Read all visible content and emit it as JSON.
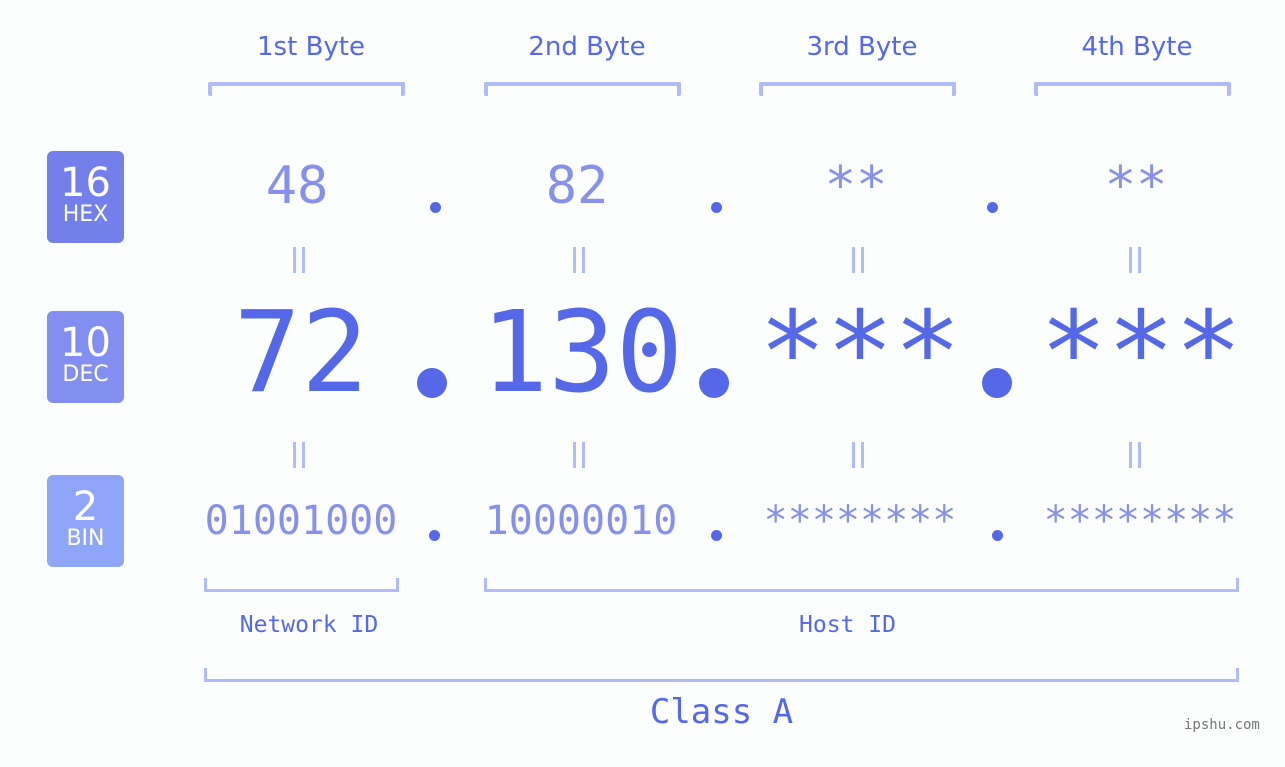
{
  "bytes": {
    "headers": [
      "1st Byte",
      "2nd Byte",
      "3rd Byte",
      "4th Byte"
    ]
  },
  "badges": {
    "hex": {
      "num": "16",
      "label": "HEX",
      "color": "#7380ec"
    },
    "dec": {
      "num": "10",
      "label": "DEC",
      "color": "#838ff0"
    },
    "bin": {
      "num": "2",
      "label": "BIN",
      "color": "#8fa6f8"
    }
  },
  "hex": [
    "48",
    "82",
    "**",
    "**"
  ],
  "dec": [
    "72",
    "130",
    "***",
    "***"
  ],
  "bin": [
    "01001000",
    "10000010",
    "********",
    "********"
  ],
  "separator": ".",
  "labels": {
    "network_id": "Network ID",
    "host_id": "Host ID",
    "class": "Class A"
  },
  "watermark": "ipshu.com",
  "colors": {
    "primary": "#5468e8",
    "secondary": "#8790eb",
    "bracket": "#b1bbf7"
  }
}
